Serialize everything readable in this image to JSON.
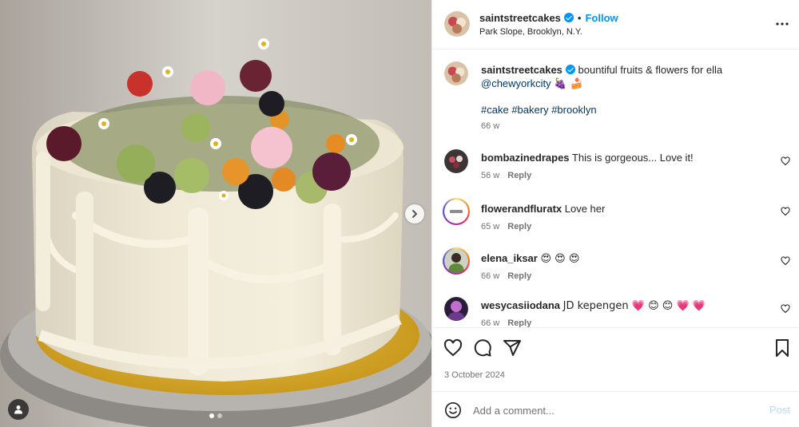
{
  "header": {
    "username": "saintstreetcakes",
    "separator": "•",
    "follow_label": "Follow",
    "location": "Park Slope, Brooklyn, N.Y."
  },
  "caption": {
    "username": "saintstreetcakes",
    "text": "bountiful fruits & flowers for ella",
    "mention": "@chewyorkcity",
    "emojis": "🍇 🍰",
    "hashtags": [
      "#cake",
      "#bakery",
      "#brooklyn"
    ],
    "time": "66 w"
  },
  "comments": [
    {
      "username": "bombazinedrapes",
      "text": "This is gorgeous... Love it!",
      "time": "56 w",
      "reply_label": "Reply"
    },
    {
      "username": "flowerandfluratx",
      "text": "Love her",
      "time": "65 w",
      "reply_label": "Reply"
    },
    {
      "username": "elena_iksar",
      "text": "😍 😍 😍",
      "time": "66 w",
      "reply_label": "Reply"
    },
    {
      "username": "wesycasiiodana",
      "text": "JD kepengen 💗 😊 😊 💗 💗",
      "time": "66 w",
      "reply_label": "Reply"
    }
  ],
  "actions": {
    "like_icon": "heart-icon",
    "comment_icon": "comment-icon",
    "share_icon": "share-icon",
    "save_icon": "bookmark-icon"
  },
  "post_date": "3 October 2024",
  "add_comment": {
    "placeholder": "Add a comment...",
    "post_label": "Post"
  },
  "media": {
    "carousel_count": 2,
    "active_index": 0,
    "next_icon": "chevron-right-icon",
    "tag_icon": "user-tag-icon"
  },
  "colors": {
    "accent": "#0095f6",
    "link": "#00376b",
    "muted": "#737373",
    "text": "#262626",
    "post_disabled": "#b3dbff",
    "border": "#efefef"
  }
}
